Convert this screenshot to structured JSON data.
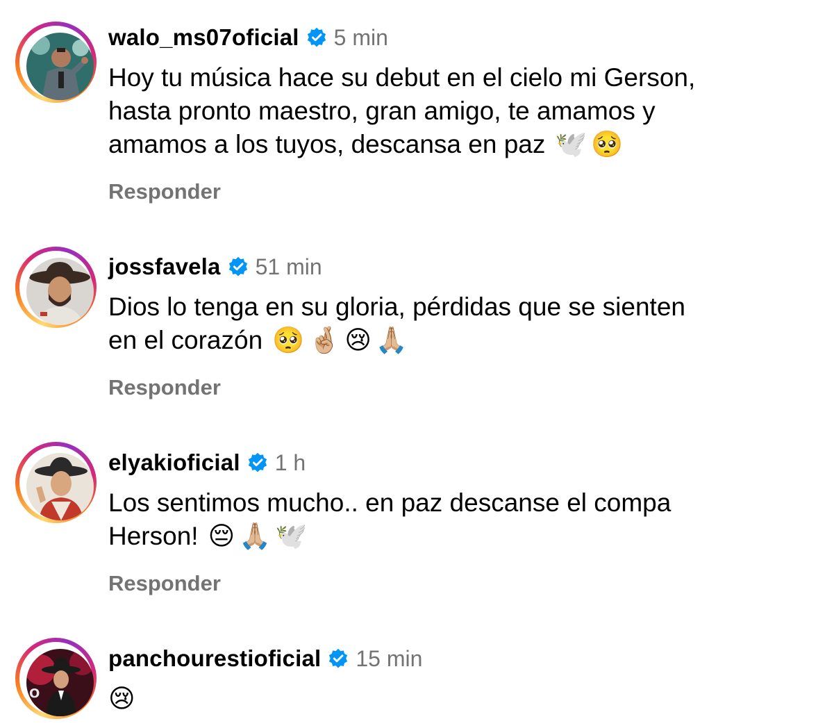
{
  "comments": [
    {
      "username": "walo_ms07oficial",
      "time": "5 min",
      "text_lines": [
        "Hoy tu música hace su debut en el cielo mi Gerson,",
        "hasta pronto maestro, gran amigo, te amamos y",
        "amamos a los tuyos, descansa en paz"
      ],
      "emojis": [
        "🕊️",
        "🥺"
      ],
      "reply": "Responder"
    },
    {
      "username": "jossfavela",
      "time": "51 min",
      "text_lines": [
        "Dios lo tenga en su gloria, pérdidas que se sienten",
        "en el corazón"
      ],
      "emojis": [
        "🥺",
        "🤞🏼",
        "😢",
        "🙏🏼"
      ],
      "reply": "Responder"
    },
    {
      "username": "elyakioficial",
      "time": "1 h",
      "text_lines": [
        "Los sentimos mucho.. en paz descanse el compa",
        "Herson!"
      ],
      "emojis": [
        "😔",
        "🙏🏼",
        "🕊️"
      ],
      "reply": "Responder"
    },
    {
      "username": "panchourestioficial",
      "time": "15 min",
      "text_lines": [
        ""
      ],
      "emojis": [
        "😢"
      ],
      "reply": ""
    }
  ],
  "colors": {
    "verified_badge": "#0095f6",
    "secondary_text": "#737373",
    "ring_gradient": [
      "#feda75",
      "#fa7e1e",
      "#d62976",
      "#962fbf"
    ]
  },
  "icons": {
    "verified": "verified-badge-icon"
  }
}
